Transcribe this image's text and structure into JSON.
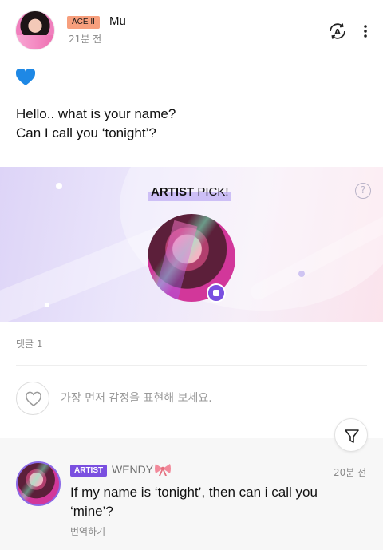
{
  "post": {
    "author": {
      "rank": "ACE II",
      "name": "Mu",
      "time": "21분 전"
    },
    "icons": {
      "translate": "translate-icon",
      "more": "more-vertical-icon",
      "heart": "blue-heart-emoji"
    },
    "text_lines": [
      "Hello.. what is your name?",
      "Can I call you ‘tonight’?"
    ]
  },
  "artist_pick": {
    "title_bold": "ARTIST",
    "title_rest": " PICK!",
    "help": "?"
  },
  "comments": {
    "count_label": "댓글 1",
    "reaction_prompt": "가장 먼저 감정을 표현해 보세요.",
    "items": [
      {
        "tag": "ARTIST",
        "name": "WENDY",
        "time": "20분 전",
        "text_lines": [
          "If my name is ‘tonight’, then can i call you",
          "‘mine’?"
        ],
        "translate": "번역하기"
      }
    ]
  },
  "colors": {
    "rank_badge": "#f79f7d",
    "artist_accent": "#7a4fe0",
    "heart": "#1e88e5"
  }
}
